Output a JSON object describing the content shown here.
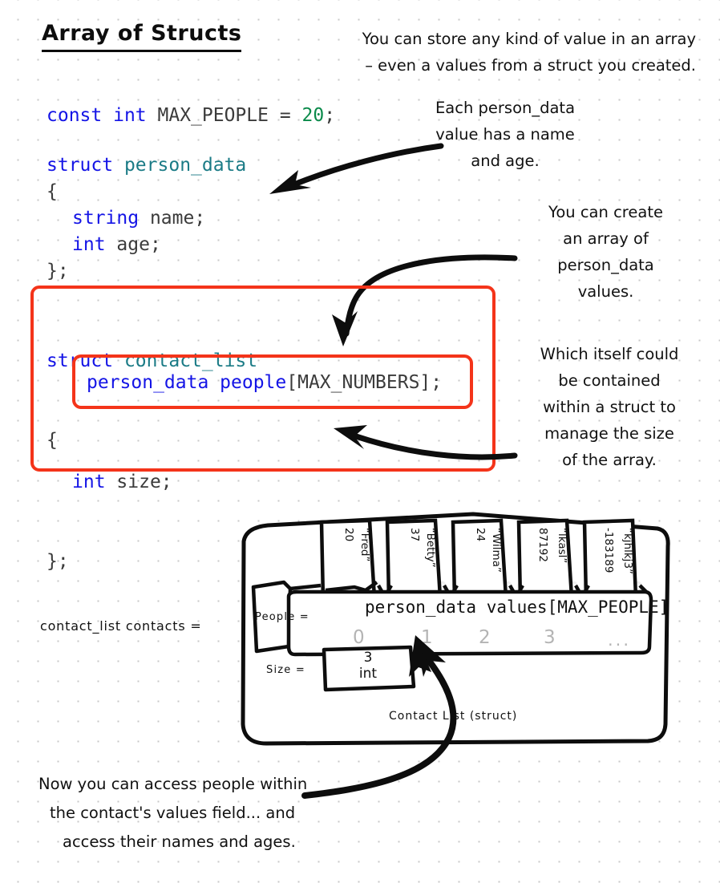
{
  "page": {
    "title": "Array of Structs",
    "background": "#ffffff",
    "dot_grid_color": "#c8c8c8",
    "accent_red": "#f4341a"
  },
  "intro_note": [
    "You can store any kind of value in an array",
    "– even a values from a struct you created."
  ],
  "code_blocks": {
    "max_people": [
      {
        "kw": "const",
        "space": " ",
        "kw2": "int",
        "ident": " MAX_PEOPLE = ",
        "num": "20",
        "tail": ";"
      }
    ],
    "person_data": {
      "line1_kw": "struct",
      "line1_type": "person_data",
      "line2": "{",
      "line3_kw": "string",
      "line3_id": "name;",
      "line4_kw": "int",
      "line4_id": "age;",
      "line5": "};"
    },
    "contact_list": {
      "line1_kw": "struct",
      "line1_type": "contact_list",
      "line2": "{",
      "members_kw": "person_data people",
      "members_tail": "[MAX_NUMBERS];",
      "line4_kw": "int",
      "line4_id": "size;",
      "line5": "};"
    }
  },
  "annotations": {
    "person_data_note": [
      "Each person_data",
      "value has a name",
      "and age."
    ],
    "array_note": [
      "You can create",
      "an array of",
      "person_data",
      "values."
    ],
    "struct_note": [
      "Which itself could",
      "be contained",
      "within a struct to",
      "manage the size",
      "of the array."
    ],
    "bottom_note": [
      "Now you can access people within",
      "the contact's values field... and",
      "access their names and ages."
    ]
  },
  "diagram": {
    "variable_declaration": "contact_list contacts =",
    "people_label": "People =",
    "size_label": "Size =",
    "array_title": "person_data values[MAX_PEOPLE]",
    "struct_caption": "Contact List (struct)",
    "indices": [
      "0",
      "1",
      "2",
      "3"
    ],
    "ellipsis": "...",
    "size_value": "3",
    "size_type": "int",
    "cards": [
      {
        "name": "“Fred”",
        "age": "20"
      },
      {
        "name": "“Betty”",
        "age": "37"
      },
      {
        "name": "“Wilma”",
        "age": "24"
      },
      {
        "name": "“lkasl”",
        "age": "87192"
      },
      {
        "name": "“kjhlkj3”",
        "age": "-183189"
      }
    ]
  }
}
